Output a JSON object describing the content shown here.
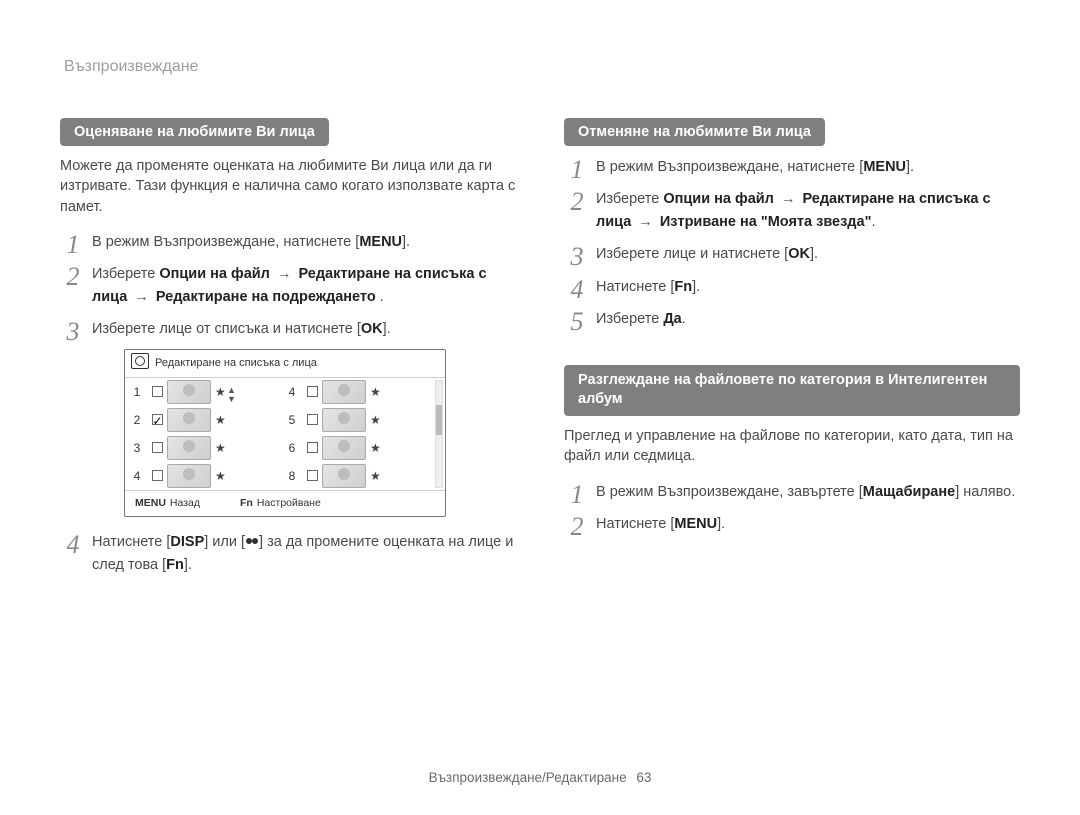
{
  "breadcrumb": "Възпроизвеждане",
  "left": {
    "heading": "Оценяване на любимите Ви лица",
    "intro": "Можете да променяте оценката на любимите Ви лица или да ги изтривате. Тази функция е налична само когато използвате карта с памет.",
    "steps": {
      "s1_a": "В режим Възпроизвеждане, натиснете [",
      "s1_btn": "MENU",
      "s1_b": "].",
      "s2_a": "Изберете ",
      "s2_b1": "Опции на файл",
      "s2_arrow1": " → ",
      "s2_b2": "Редактиране на списъка с лица",
      "s2_arrow2": " → ",
      "s2_b3": "Редактиране на подреждането",
      "s2_c": " .",
      "s3_a": "Изберете лице от списъка и натиснете [",
      "s3_btn": "OK",
      "s3_b": "].",
      "s4_a": "Натиснете [",
      "s4_btn1": "DISP",
      "s4_mid": "] или [",
      "s4_btn2_alt": "макро",
      "s4_b": "] за да промените оценката на лице и след това [",
      "s4_btn3": "Fn",
      "s4_c": "]."
    },
    "lcd": {
      "title": "Редактиране на списъка с лица",
      "rows": [
        {
          "left_n": "1",
          "left_checked": false,
          "right_n": "4",
          "right_checked": false
        },
        {
          "left_n": "2",
          "left_checked": true,
          "right_n": "5",
          "right_checked": false
        },
        {
          "left_n": "3",
          "left_checked": false,
          "right_n": "6",
          "right_checked": false
        },
        {
          "left_n": "4",
          "left_checked": false,
          "right_n": "8",
          "right_checked": false
        }
      ],
      "star": "★",
      "back_key": "MENU",
      "back_label": "Назад",
      "set_key": "Fn",
      "set_label": "Настройване"
    }
  },
  "right": {
    "heading1": "Отменяне на любимите Ви лица",
    "steps1": {
      "s1_a": "В режим Възпроизвеждане, натиснете [",
      "s1_btn": "MENU",
      "s1_b": "].",
      "s2_a": "Изберете ",
      "s2_b1": "Опции на файл",
      "s2_arrow1": " → ",
      "s2_b2": "Редактиране на списъка с лица",
      "s2_arrow2": " → ",
      "s2_b3": "Изтриване на \"Моята звезда\"",
      "s2_c": ".",
      "s3_a": "Изберете лице и натиснете [",
      "s3_btn": "OK",
      "s3_b": "].",
      "s4_a": "Натиснете  [",
      "s4_btn": "Fn",
      "s4_b": "].",
      "s5_a": "Изберете ",
      "s5_b": "Да",
      "s5_c": "."
    },
    "heading2": "Разглеждане на файловете по категория в Интелигентен албум",
    "intro2": "Преглед и управление на файлове по категории, като дата, тип на файл или седмица.",
    "steps2": {
      "s1_a": "В режим Възпроизвеждане, завъртете [",
      "s1_btn": "Мащабиране",
      "s1_b": "] наляво.",
      "s2_a": "Натиснете [",
      "s2_btn": "MENU",
      "s2_b": "]."
    }
  },
  "footer": {
    "section": "Възпроизвеждане/Редактиране",
    "page": "63"
  }
}
